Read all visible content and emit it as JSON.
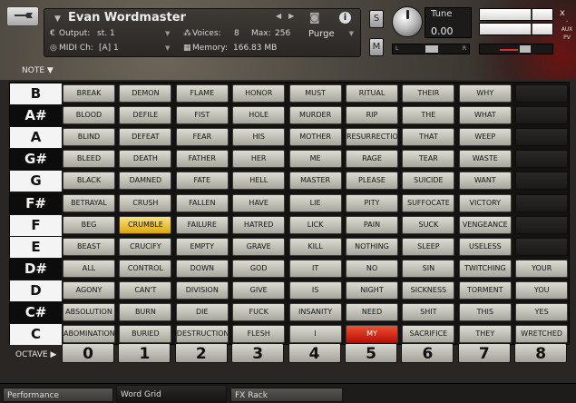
{
  "header": {
    "instrument_name": "Evan Wordmaster",
    "output_label": "Output:",
    "output_value": "st. 1",
    "voices_label": "Voices:",
    "voices_value": "8",
    "max_label": "Max:",
    "max_value": "256",
    "purge_label": "Purge",
    "midi_label": "MIDI Ch:",
    "midi_value": "[A] 1",
    "memory_label": "Memory:",
    "memory_value": "166.83 MB",
    "solo_label": "S",
    "mute_label": "M",
    "tune_label": "Tune",
    "tune_value": "0.00",
    "pan_left": "L",
    "pan_right": "R",
    "aux_label": "AUX",
    "pv_label": "PV",
    "close_label": "x",
    "minus_label": "-"
  },
  "note_header": "NOTE ▼",
  "octave_header": "OCTAVE ▶",
  "notes": [
    "B",
    "A#",
    "A",
    "G#",
    "G",
    "F#",
    "F",
    "E",
    "D#",
    "D",
    "C#",
    "C"
  ],
  "note_colors": [
    "white",
    "black",
    "white",
    "black",
    "white",
    "black",
    "white",
    "white",
    "black",
    "white",
    "black",
    "white"
  ],
  "octaves": [
    "0",
    "1",
    "2",
    "3",
    "4",
    "5",
    "6",
    "7",
    "8"
  ],
  "grid": [
    [
      "BREAK",
      "DEMON",
      "FLAME",
      "HONOR",
      "MUST",
      "RITUAL",
      "THEIR",
      "WHY"
    ],
    [
      "BLOOD",
      "DEFILE",
      "FIST",
      "HOLE",
      "MURDER",
      "RIP",
      "THE",
      "WHAT"
    ],
    [
      "BLIND",
      "DEFEAT",
      "FEAR",
      "HIS",
      "MOTHER",
      "RESURRECTION",
      "THAT",
      "WEEP"
    ],
    [
      "BLEED",
      "DEATH",
      "FATHER",
      "HER",
      "ME",
      "RAGE",
      "TEAR",
      "WASTE"
    ],
    [
      "BLACK",
      "DAMNED",
      "FATE",
      "HELL",
      "MASTER",
      "PLEASE",
      "SUICIDE",
      "WANT"
    ],
    [
      "BETRAYAL",
      "CRUSH",
      "FALLEN",
      "HAVE",
      "LIE",
      "PITY",
      "SUFFOCATE",
      "VICTORY"
    ],
    [
      "BEG",
      "CRUMBLE",
      "FAILURE",
      "HATRED",
      "LICK",
      "PAIN",
      "SUCK",
      "VENGEANCE"
    ],
    [
      "BEAST",
      "CRUCIFY",
      "EMPTY",
      "GRAVE",
      "KILL",
      "NOTHING",
      "SLEEP",
      "USELESS"
    ],
    [
      "ALL",
      "CONTROL",
      "DOWN",
      "GOD",
      "IT",
      "NO",
      "SIN",
      "TWITCHING",
      "YOUR"
    ],
    [
      "AGONY",
      "CAN'T",
      "DIVISION",
      "GIVE",
      "IS",
      "NIGHT",
      "SICKNESS",
      "TORMENT",
      "YOU"
    ],
    [
      "ABSOLUTION",
      "BURN",
      "DIE",
      "FUCK",
      "INSANITY",
      "NEED",
      "SHIT",
      "THIS",
      "YES"
    ],
    [
      "ABOMINATION",
      "BURIED",
      "DESTRUCTION",
      "FLESH",
      "I",
      "MY",
      "SACRIFICE",
      "THEY",
      "WRETCHED"
    ]
  ],
  "highlighted": {
    "yellow": "CRUMBLE",
    "red": "MY"
  },
  "colors": {
    "highlight_yellow": "#f2c232",
    "highlight_red": "#e03a1c"
  },
  "tabs": [
    {
      "label": "Performance",
      "active": false
    },
    {
      "label": "Word Grid",
      "active": true
    },
    {
      "label": "FX Rack",
      "active": false
    }
  ]
}
